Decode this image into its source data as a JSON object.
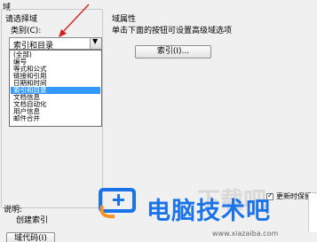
{
  "dialog": {
    "title_fragment": "域"
  },
  "left": {
    "choose_field_label": "请选择域",
    "category_label": "类别(C):",
    "category_value": "索引和目录",
    "category_options": [
      "(全部)",
      "编号",
      "等式和公式",
      "链接和引用",
      "日期和时间",
      "索引和目录",
      "文档信息",
      "文档自动化",
      "用户信息",
      "邮件合并"
    ],
    "selected_option": "索引和目录",
    "description_label": "说明:",
    "description_text": "创建索引",
    "field_codes_button": "域代码(I)"
  },
  "right": {
    "properties_title": "域属性",
    "hint": "单击下面的按钮可设置高级域选项",
    "index_button": "索引(I)...",
    "update_checkbox_label": "更新时保留格"
  },
  "watermark": {
    "brand": "电脑技术吧",
    "url": "www.xiazaiba.com",
    "bg_text": "下载吧"
  },
  "colors": {
    "selection": "#3399ff",
    "arrow": "#d22020",
    "brand_blue": "#1a73e8",
    "brand_orange": "#f7931e"
  }
}
